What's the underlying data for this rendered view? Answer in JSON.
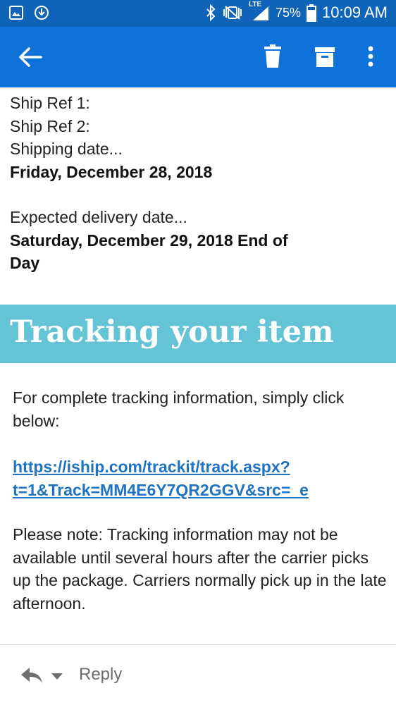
{
  "status_bar": {
    "time": "10:09 AM",
    "battery_percent": "75%",
    "network_type": "LTE",
    "icons": [
      "gallery-icon",
      "download-icon",
      "bluetooth-icon",
      "vibrate-icon",
      "signal-icon",
      "battery-icon"
    ]
  },
  "app_bar": {
    "icons": [
      "back-arrow-icon",
      "delete-icon",
      "archive-icon",
      "more-vertical-icon"
    ]
  },
  "email": {
    "partial_top_line": "Ship...",
    "ship_ref_1": "Ship Ref 1:",
    "ship_ref_2": "Ship Ref 2:",
    "shipping_date_label": "Shipping date...",
    "shipping_date_value": "Friday, December 28, 2018",
    "delivery_date_label": "Expected delivery date...",
    "delivery_date_value_line1": "Saturday, December 29, 2018 End of",
    "delivery_date_value_line2": "Day",
    "tracking_heading": "Tracking your item",
    "tracking_intro": "For complete tracking information, simply click below:",
    "tracking_link_line1": "https://iship.com/trackit/track.aspx?",
    "tracking_link_line2": "t=1&Track=MM4E6Y7QR2GGV&src=_e",
    "tracking_note": "Please note: Tracking information may not be available until several hours after the carrier picks up the package. Carriers normally pick up in the late afternoon."
  },
  "footer": {
    "reply_label": "Reply"
  },
  "colors": {
    "status_bar": "#0f63b8",
    "app_bar": "#0e72d8",
    "tracking_banner": "#65c3d6",
    "link": "#1f73c2"
  }
}
